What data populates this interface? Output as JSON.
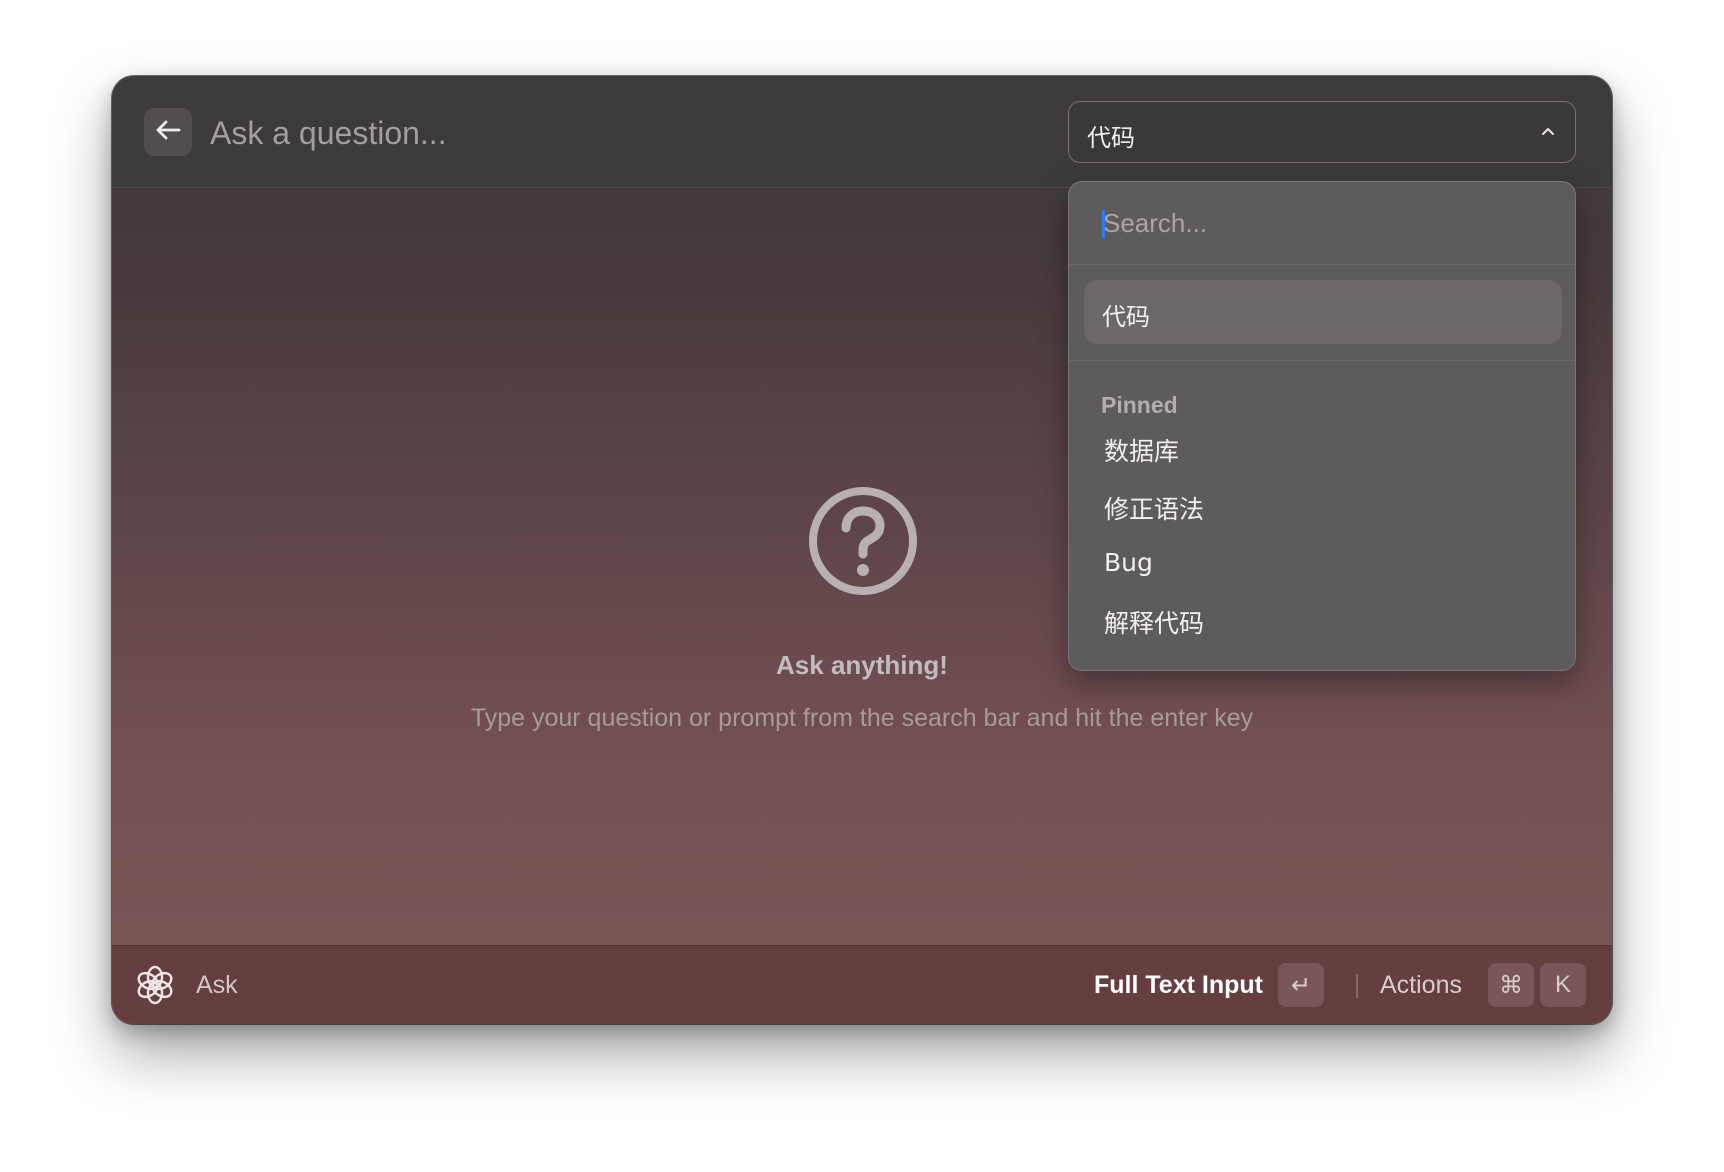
{
  "header": {
    "back_icon": "arrow-left-icon",
    "question_placeholder": "Ask a question...",
    "question_value": ""
  },
  "model_select": {
    "selected": "代码",
    "chevron_icon": "chevron-up-icon",
    "search_placeholder": "Search...",
    "search_value": "",
    "current_item": "代码",
    "section_title": "Pinned",
    "items": [
      "数据库",
      "修正语法",
      "Bug",
      "解释代码"
    ]
  },
  "empty_state": {
    "icon": "question-circle-icon",
    "title": "Ask anything!",
    "subtitle": "Type your question or prompt from the search bar and hit the enter key"
  },
  "footer": {
    "app_icon": "openai-logo-icon",
    "command_label": "Ask",
    "primary_action_label": "Full Text Input",
    "primary_action_key": "↵",
    "actions_label": "Actions",
    "actions_keys": [
      "⌘",
      "K"
    ]
  },
  "colors": {
    "caret": "#2f7bf5",
    "footer_bg": "#653e40",
    "topbar_bg": "#3c3a3b"
  }
}
